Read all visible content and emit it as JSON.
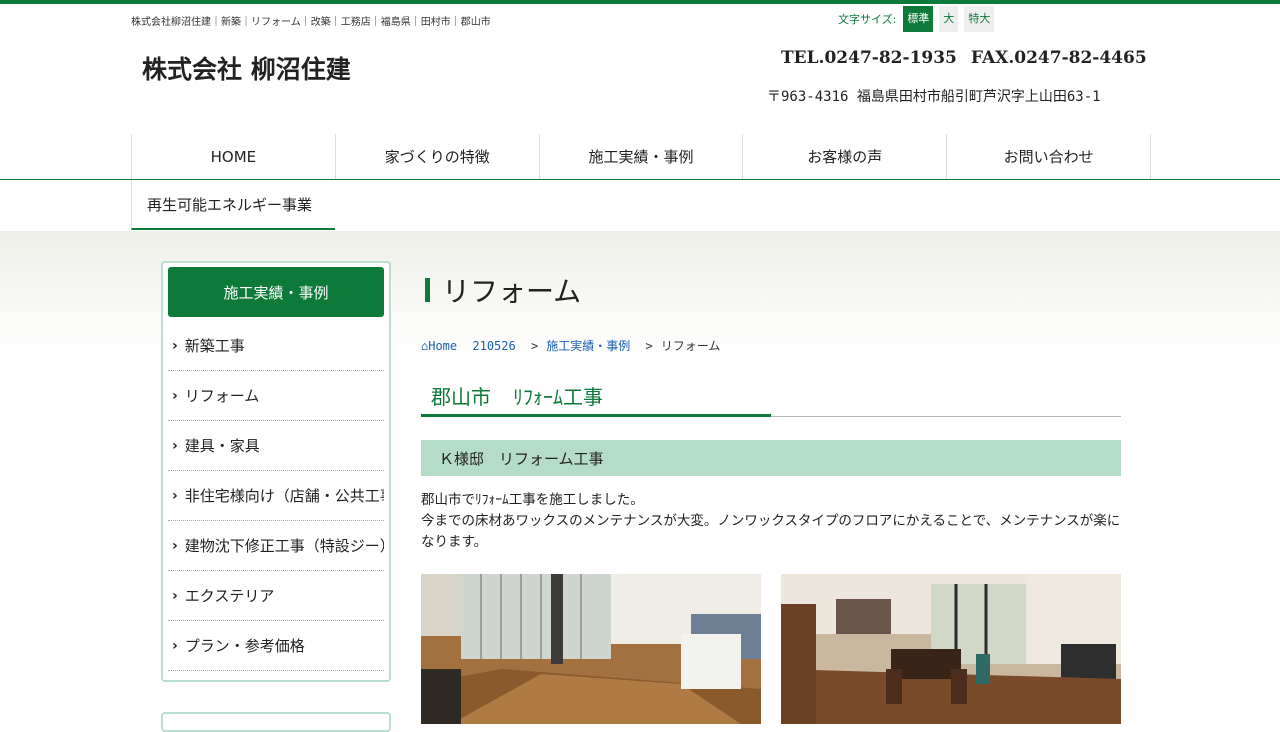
{
  "header": {
    "tagline": "株式会社柳沼住建｜新築｜リフォーム｜改築｜工務店｜福島県｜田村市｜郡山市",
    "font_size": {
      "label": "文字サイズ:",
      "options": [
        "標準",
        "大",
        "特大"
      ],
      "active_index": 0
    },
    "company_name": "株式会社 柳沼住建",
    "tel": "TEL.0247-82-1935",
    "fax": "FAX.0247-82-4465",
    "address": "〒963-4316 福島県田村市船引町芦沢字上山田63-1"
  },
  "nav": {
    "items": [
      "HOME",
      "家づくりの特徴",
      "施工実績・事例",
      "お客様の声",
      "お問い合わせ"
    ],
    "second_row": "再生可能エネルギー事業"
  },
  "sidebar": {
    "heading": "施工実績・事例",
    "items": [
      "新築工事",
      "リフォーム",
      "建具・家具",
      "非住宅様向け（店舗・公共工事）",
      "建物沈下修正工事（特設ジー）",
      "エクステリア",
      "プラン・参考価格"
    ]
  },
  "main": {
    "page_title": "リフォーム",
    "breadcrumb": {
      "home": "Home",
      "post_id": "210526",
      "category": "施工実績・事例",
      "current": "リフォーム"
    },
    "post_title_city": "郡山市",
    "post_title_rest": "ﾘﾌｫｰﾑ工事",
    "subheading": "Ｋ様邸　リフォーム工事",
    "body_lines": [
      "郡山市でﾘﾌｫｰﾑ工事を施工しました。",
      "今までの床材あワックスのメンテナンスが大変。ノンワックスタイプのフロアにかえることで、メンテナンスが楽になります。"
    ]
  },
  "colors": {
    "brand_green": "#0e7a3a",
    "subhead_bg": "#b4dcc7",
    "link_blue": "#1a5fb4"
  }
}
